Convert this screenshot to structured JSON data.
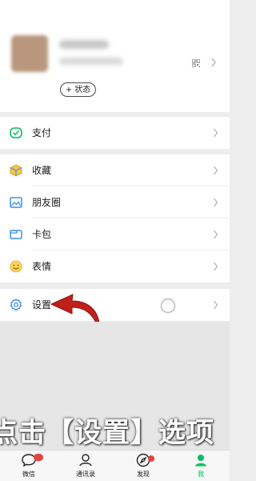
{
  "profile": {
    "status_label": "+ 状态"
  },
  "menu": [
    {
      "label": "支付",
      "icon": "payment-icon"
    },
    {
      "label": "收藏",
      "icon": "favorites-icon"
    },
    {
      "label": "朋友圈",
      "icon": "moments-icon"
    },
    {
      "label": "卡包",
      "icon": "cards-icon"
    },
    {
      "label": "表情",
      "icon": "stickers-icon"
    },
    {
      "label": "设置",
      "icon": "settings-icon"
    }
  ],
  "caption": "点击【设置】选项",
  "tabs": [
    {
      "label": "微信",
      "icon": "chat-icon"
    },
    {
      "label": "通讯录",
      "icon": "contacts-icon"
    },
    {
      "label": "发现",
      "icon": "discover-icon"
    },
    {
      "label": "我",
      "icon": "me-icon",
      "active": true
    }
  ],
  "colors": {
    "accent": "#07c160",
    "arrow": "#c0201a",
    "background": "#ededed"
  }
}
